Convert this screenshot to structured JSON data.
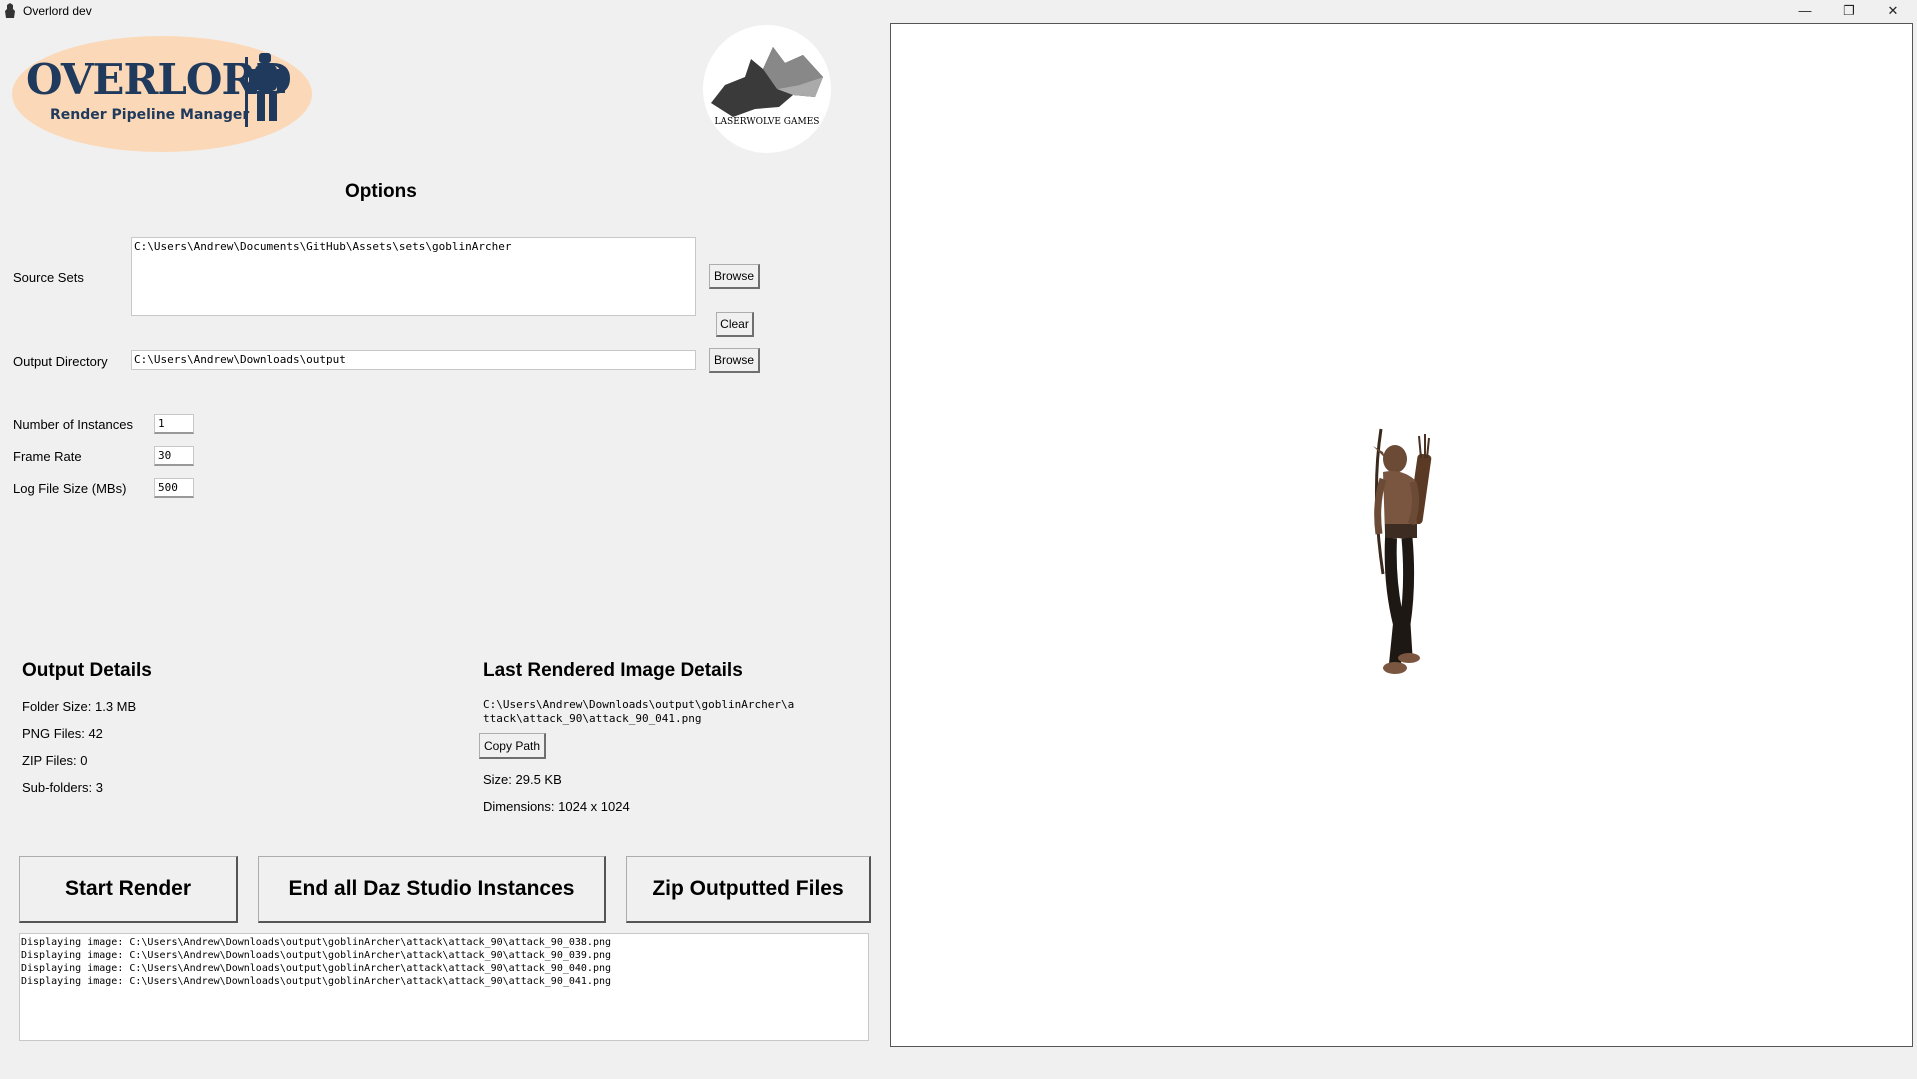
{
  "window": {
    "title": "Overlord dev",
    "controls": [
      "minimize",
      "restore",
      "close"
    ]
  },
  "logo": {
    "title": "OVERLORD",
    "subtitle": "Render Pipeline Manager",
    "partner": "LASERWOLVE GAMES"
  },
  "options": {
    "heading": "Options",
    "source_sets": {
      "label": "Source Sets",
      "value": "C:\\Users\\Andrew\\Documents\\GitHub\\Assets\\sets\\goblinArcher",
      "browse_label": "Browse",
      "clear_label": "Clear"
    },
    "output_directory": {
      "label": "Output Directory",
      "value": "C:\\Users\\Andrew\\Downloads\\output",
      "browse_label": "Browse"
    },
    "num_instances": {
      "label": "Number of Instances",
      "value": "1"
    },
    "frame_rate": {
      "label": "Frame Rate",
      "value": "30"
    },
    "log_size": {
      "label": "Log File Size (MBs)",
      "value": "500"
    }
  },
  "output_details": {
    "heading": "Output Details",
    "folder_size": "Folder Size: 1.3 MB",
    "png_files": "PNG Files: 42",
    "zip_files": "ZIP Files: 0",
    "sub_folders": "Sub-folders: 3"
  },
  "last_image": {
    "heading": "Last Rendered Image Details",
    "path_line1": "C:\\Users\\Andrew\\Downloads\\output\\goblinArcher\\a",
    "path_line2": "ttack\\attack_90\\attack_90_041.png",
    "copy_label": "Copy Path",
    "size": "Size: 29.5 KB",
    "dimensions": "Dimensions: 1024 x 1024"
  },
  "actions": {
    "start": "Start Render",
    "end": "End all Daz Studio Instances",
    "zip": "Zip Outputted Files"
  },
  "log": [
    "Displaying image: C:\\Users\\Andrew\\Downloads\\output\\goblinArcher\\attack\\attack_90\\attack_90_038.png",
    "Displaying image: C:\\Users\\Andrew\\Downloads\\output\\goblinArcher\\attack\\attack_90\\attack_90_039.png",
    "Displaying image: C:\\Users\\Andrew\\Downloads\\output\\goblinArcher\\attack\\attack_90\\attack_90_040.png",
    "Displaying image: C:\\Users\\Andrew\\Downloads\\output\\goblinArcher\\attack\\attack_90\\attack_90_041.png"
  ],
  "colors": {
    "window_bg": "#f0f0f0",
    "logo_oval": "#fbd9b8",
    "logo_text": "#1f3a5c"
  }
}
